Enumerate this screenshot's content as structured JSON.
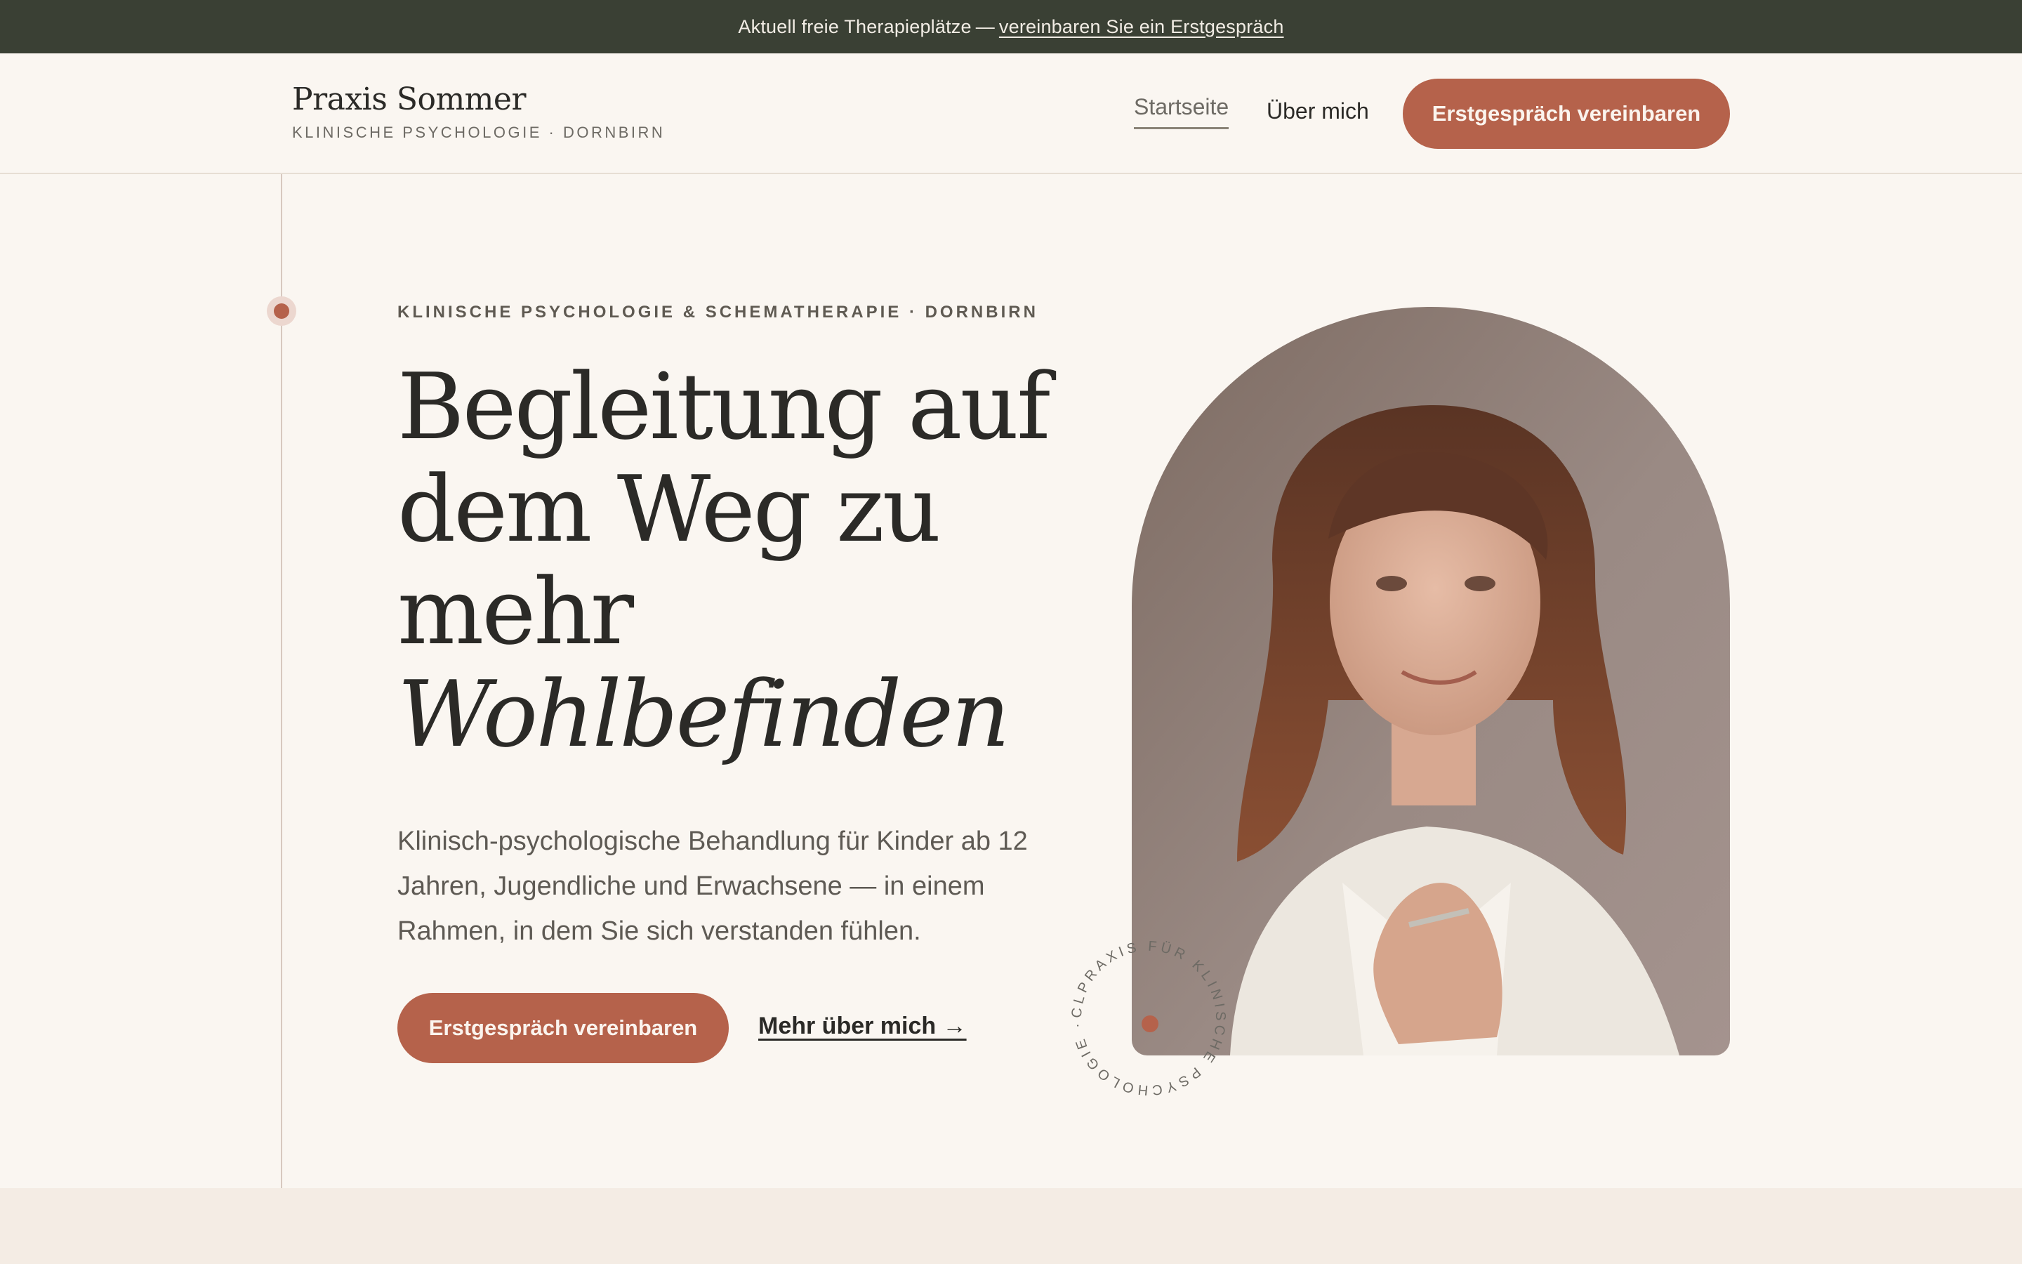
{
  "announcement": {
    "text": "Aktuell freie Therapieplätze",
    "separator": "—",
    "link": "vereinbaren Sie ein Erstgespräch"
  },
  "header": {
    "brand_name": "Praxis Sommer",
    "brand_sub": "KLINISCHE PSYCHOLOGIE · DORNBIRN",
    "nav": [
      {
        "label": "Startseite",
        "active": true
      },
      {
        "label": "Über mich",
        "active": false
      }
    ],
    "cta": "Erstgespräch vereinbaren"
  },
  "hero": {
    "eyebrow": "KLINISCHE PSYCHOLOGIE & SCHEMATHERAPIE · DORNBIRN",
    "headline": [
      "Begleitung auf",
      "dem Weg zu",
      "mehr"
    ],
    "headline_italic": "Wohlbefinden",
    "lede": "Klinisch-psychologische Behandlung für Kinder ab 12 Jahren, Jugendliche und Erwachsene — in einem Rahmen, in dem Sie sich verstanden fühlen.",
    "primary_cta": "Erstgespräch vereinbaren",
    "secondary_cta": "Mehr über mich →",
    "badge_text": "CLPRAXIS FÜR KLINISCHE PSYCHOLOGIE · "
  },
  "colors": {
    "accent": "#b5624b",
    "topbar": "#3a4034",
    "background": "#faf6f1",
    "text": "#2b2a27"
  }
}
